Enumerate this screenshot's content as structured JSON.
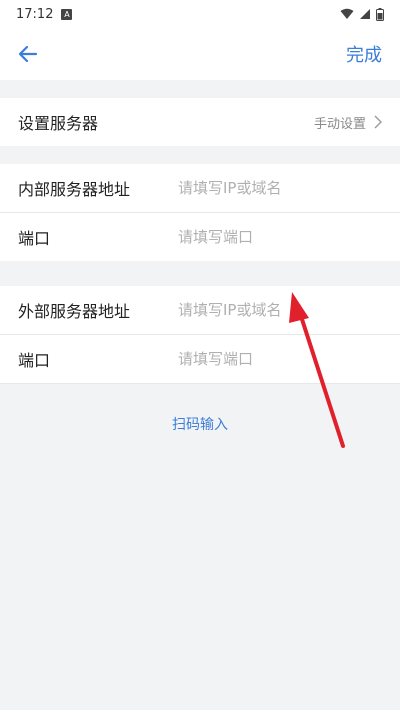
{
  "status_bar": {
    "time": "17:12",
    "notification_glyph": "A",
    "icons": [
      "wifi-icon",
      "signal-icon",
      "battery-icon"
    ]
  },
  "nav": {
    "back_icon": "back-arrow-icon",
    "done_label": "完成"
  },
  "server_setting": {
    "label": "设置服务器",
    "value": "手动设置"
  },
  "internal": {
    "address_label": "内部服务器地址",
    "address_placeholder": "请填写IP或域名",
    "port_label": "端口",
    "port_placeholder": "请填写端口"
  },
  "external": {
    "address_label": "外部服务器地址",
    "address_placeholder": "请填写IP或域名",
    "port_label": "端口",
    "port_placeholder": "请填写端口"
  },
  "scan_label": "扫码输入",
  "colors": {
    "accent": "#3b7dd8",
    "annotation_arrow": "#e0202a",
    "background": "#f2f3f5"
  }
}
